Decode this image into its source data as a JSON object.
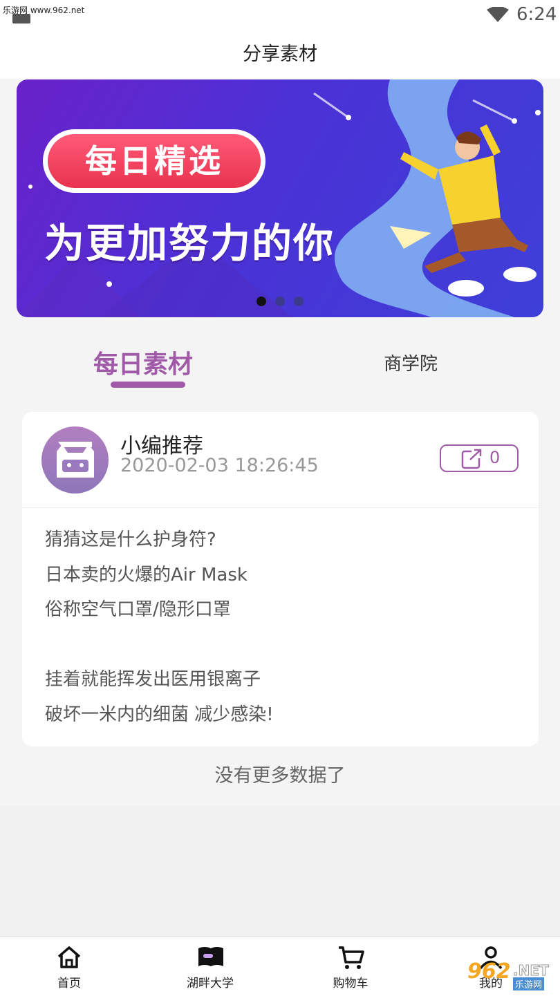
{
  "status_bar": {
    "watermark_text": "乐游网 www.962.net",
    "time": "6:24"
  },
  "header": {
    "title": "分享素材"
  },
  "banner": {
    "badge": "每日精选",
    "slogan": "为更加努力的你",
    "dots_total": 3,
    "dots_active_index": 0
  },
  "tabs": [
    {
      "label": "每日素材",
      "active": true
    },
    {
      "label": "商学院",
      "active": false
    }
  ],
  "post": {
    "author": "小编推荐",
    "time": "2020-02-03 18:26:45",
    "share_count": "0",
    "lines": [
      "猜猜这是什么护身符?",
      "日本卖的火爆的Air Mask",
      "俗称空气口罩/隐形口罩",
      "",
      "挂着就能挥发出医用银离子",
      "破坏一米内的细菌 减少感染!"
    ]
  },
  "list_footer": "没有更多数据了",
  "bottom_nav": [
    {
      "label": "首页",
      "icon": "home-icon"
    },
    {
      "label": "湖畔大学",
      "icon": "book-icon"
    },
    {
      "label": "购物车",
      "icon": "cart-icon"
    },
    {
      "label": "我的",
      "icon": "user-icon"
    }
  ],
  "watermark": {
    "brand_numbers": "962",
    "brand_suffix": ".NET",
    "brand_cn": "乐游网"
  },
  "colors": {
    "accent": "#a05aa8",
    "banner_bg": "#4a32d6",
    "badge_red": "#e8334e"
  }
}
